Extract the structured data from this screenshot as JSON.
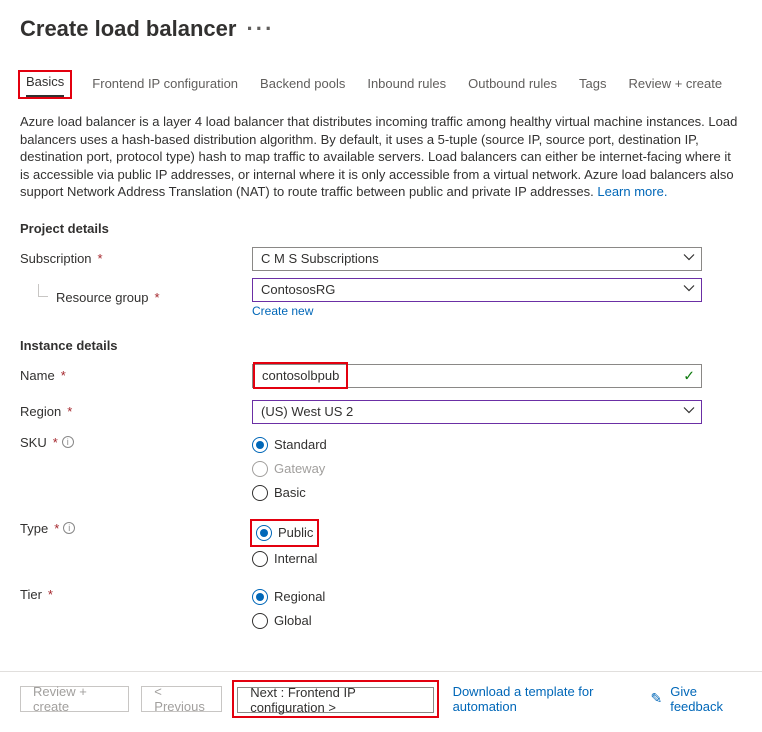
{
  "title": "Create load balancer",
  "tabs": [
    {
      "label": "Basics",
      "active": true
    },
    {
      "label": "Frontend IP configuration"
    },
    {
      "label": "Backend pools"
    },
    {
      "label": "Inbound rules"
    },
    {
      "label": "Outbound rules"
    },
    {
      "label": "Tags"
    },
    {
      "label": "Review + create"
    }
  ],
  "description": "Azure load balancer is a layer 4 load balancer that distributes incoming traffic among healthy virtual machine instances. Load balancers uses a hash-based distribution algorithm. By default, it uses a 5-tuple (source IP, source port, destination IP, destination port, protocol type) hash to map traffic to available servers. Load balancers can either be internet-facing where it is accessible via public IP addresses, or internal where it is only accessible from a virtual network. Azure load balancers also support Network Address Translation (NAT) to route traffic between public and private IP addresses.  ",
  "learn_more": "Learn more.",
  "sections": {
    "project": {
      "title": "Project details",
      "subscription_label": "Subscription",
      "subscription_value": "C M S Subscriptions",
      "rg_label": "Resource group",
      "rg_value": "ContososRG",
      "create_new": "Create new"
    },
    "instance": {
      "title": "Instance details",
      "name_label": "Name",
      "name_value": "contosolbpub",
      "region_label": "Region",
      "region_value": "(US) West US 2",
      "sku_label": "SKU",
      "sku_options": {
        "standard": "Standard",
        "gateway": "Gateway",
        "basic": "Basic"
      },
      "type_label": "Type",
      "type_options": {
        "public": "Public",
        "internal": "Internal"
      },
      "tier_label": "Tier",
      "tier_options": {
        "regional": "Regional",
        "global": "Global"
      }
    }
  },
  "footer": {
    "review": "Review + create",
    "previous": "< Previous",
    "next": "Next : Frontend IP configuration >",
    "download": "Download a template for automation",
    "feedback": "Give feedback"
  }
}
